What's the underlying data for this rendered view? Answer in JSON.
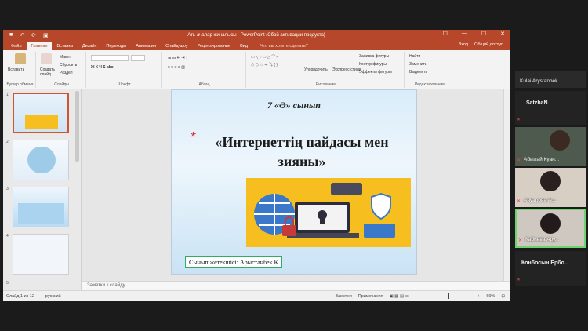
{
  "window": {
    "title": "Ать-ачалар жиналысы - PowerPoint (Сбой активации продукта)",
    "quick_access": [
      "■",
      "↶",
      "⟳",
      "▣"
    ],
    "controls": [
      "☐",
      "—",
      "☐",
      "✕"
    ]
  },
  "tabs": [
    "Файл",
    "Главная",
    "Вставка",
    "Дизайн",
    "Переходы",
    "Анимация",
    "Слайд-шоу",
    "Рецензирование",
    "Вид"
  ],
  "tab_help": "Что вы хотите сделать?",
  "tab_right": {
    "signin": "Вход",
    "share": "Общий доступ"
  },
  "ribbon": {
    "clipboard": {
      "paste": "Вставить",
      "label": "Буфер обмена"
    },
    "slides": {
      "new": "Создать слайд",
      "layout": "Макет",
      "reset": "Сбросить",
      "section": "Раздел",
      "label": "Слайды"
    },
    "font": {
      "label": "Шрифт"
    },
    "paragraph": {
      "label": "Абзац"
    },
    "drawing": {
      "arrange": "Упорядочить",
      "styles": "Экспресс-стили",
      "fill": "Заливка фигуры",
      "outline": "Контур фигуры",
      "effects": "Эффекты фигуры",
      "label": "Рисование"
    },
    "editing": {
      "find": "Найти",
      "replace": "Заменить",
      "select": "Выделить",
      "label": "Редактирование"
    }
  },
  "thumb_numbers": [
    "1",
    "2",
    "3",
    "4",
    "5"
  ],
  "slide": {
    "class": "7 «Ә» сынып",
    "star": "*",
    "title": "«Интернеттің пайдасы мен зияны»",
    "teacher": "Сынып жетекшісі: Арыстанбек К"
  },
  "notes_placeholder": "Заметки к слайду",
  "status": {
    "slide_counter": "Слайд 1 из 12",
    "language": "русский",
    "notes": "Заметки",
    "comments": "Примечания",
    "zoom": "69%"
  },
  "participants": [
    {
      "name": "Kulai Arystanbek",
      "mic_off": false,
      "video": false
    },
    {
      "name": "SatzhaN",
      "mic_off": true,
      "video": false
    },
    {
      "name": "Абылай Куан...",
      "mic_off": true,
      "video": true
    },
    {
      "name": "Ануарова Ар...",
      "mic_off": true,
      "video": true
    },
    {
      "name": "Кабиева Ару...",
      "mic_off": true,
      "video": true,
      "active": true
    },
    {
      "name": "Конбосын Ербо...",
      "mic_off": true,
      "video": false
    }
  ],
  "colors": {
    "accent": "#b7472a",
    "active_border": "#6fd36f",
    "mic_off": "#e34646"
  }
}
